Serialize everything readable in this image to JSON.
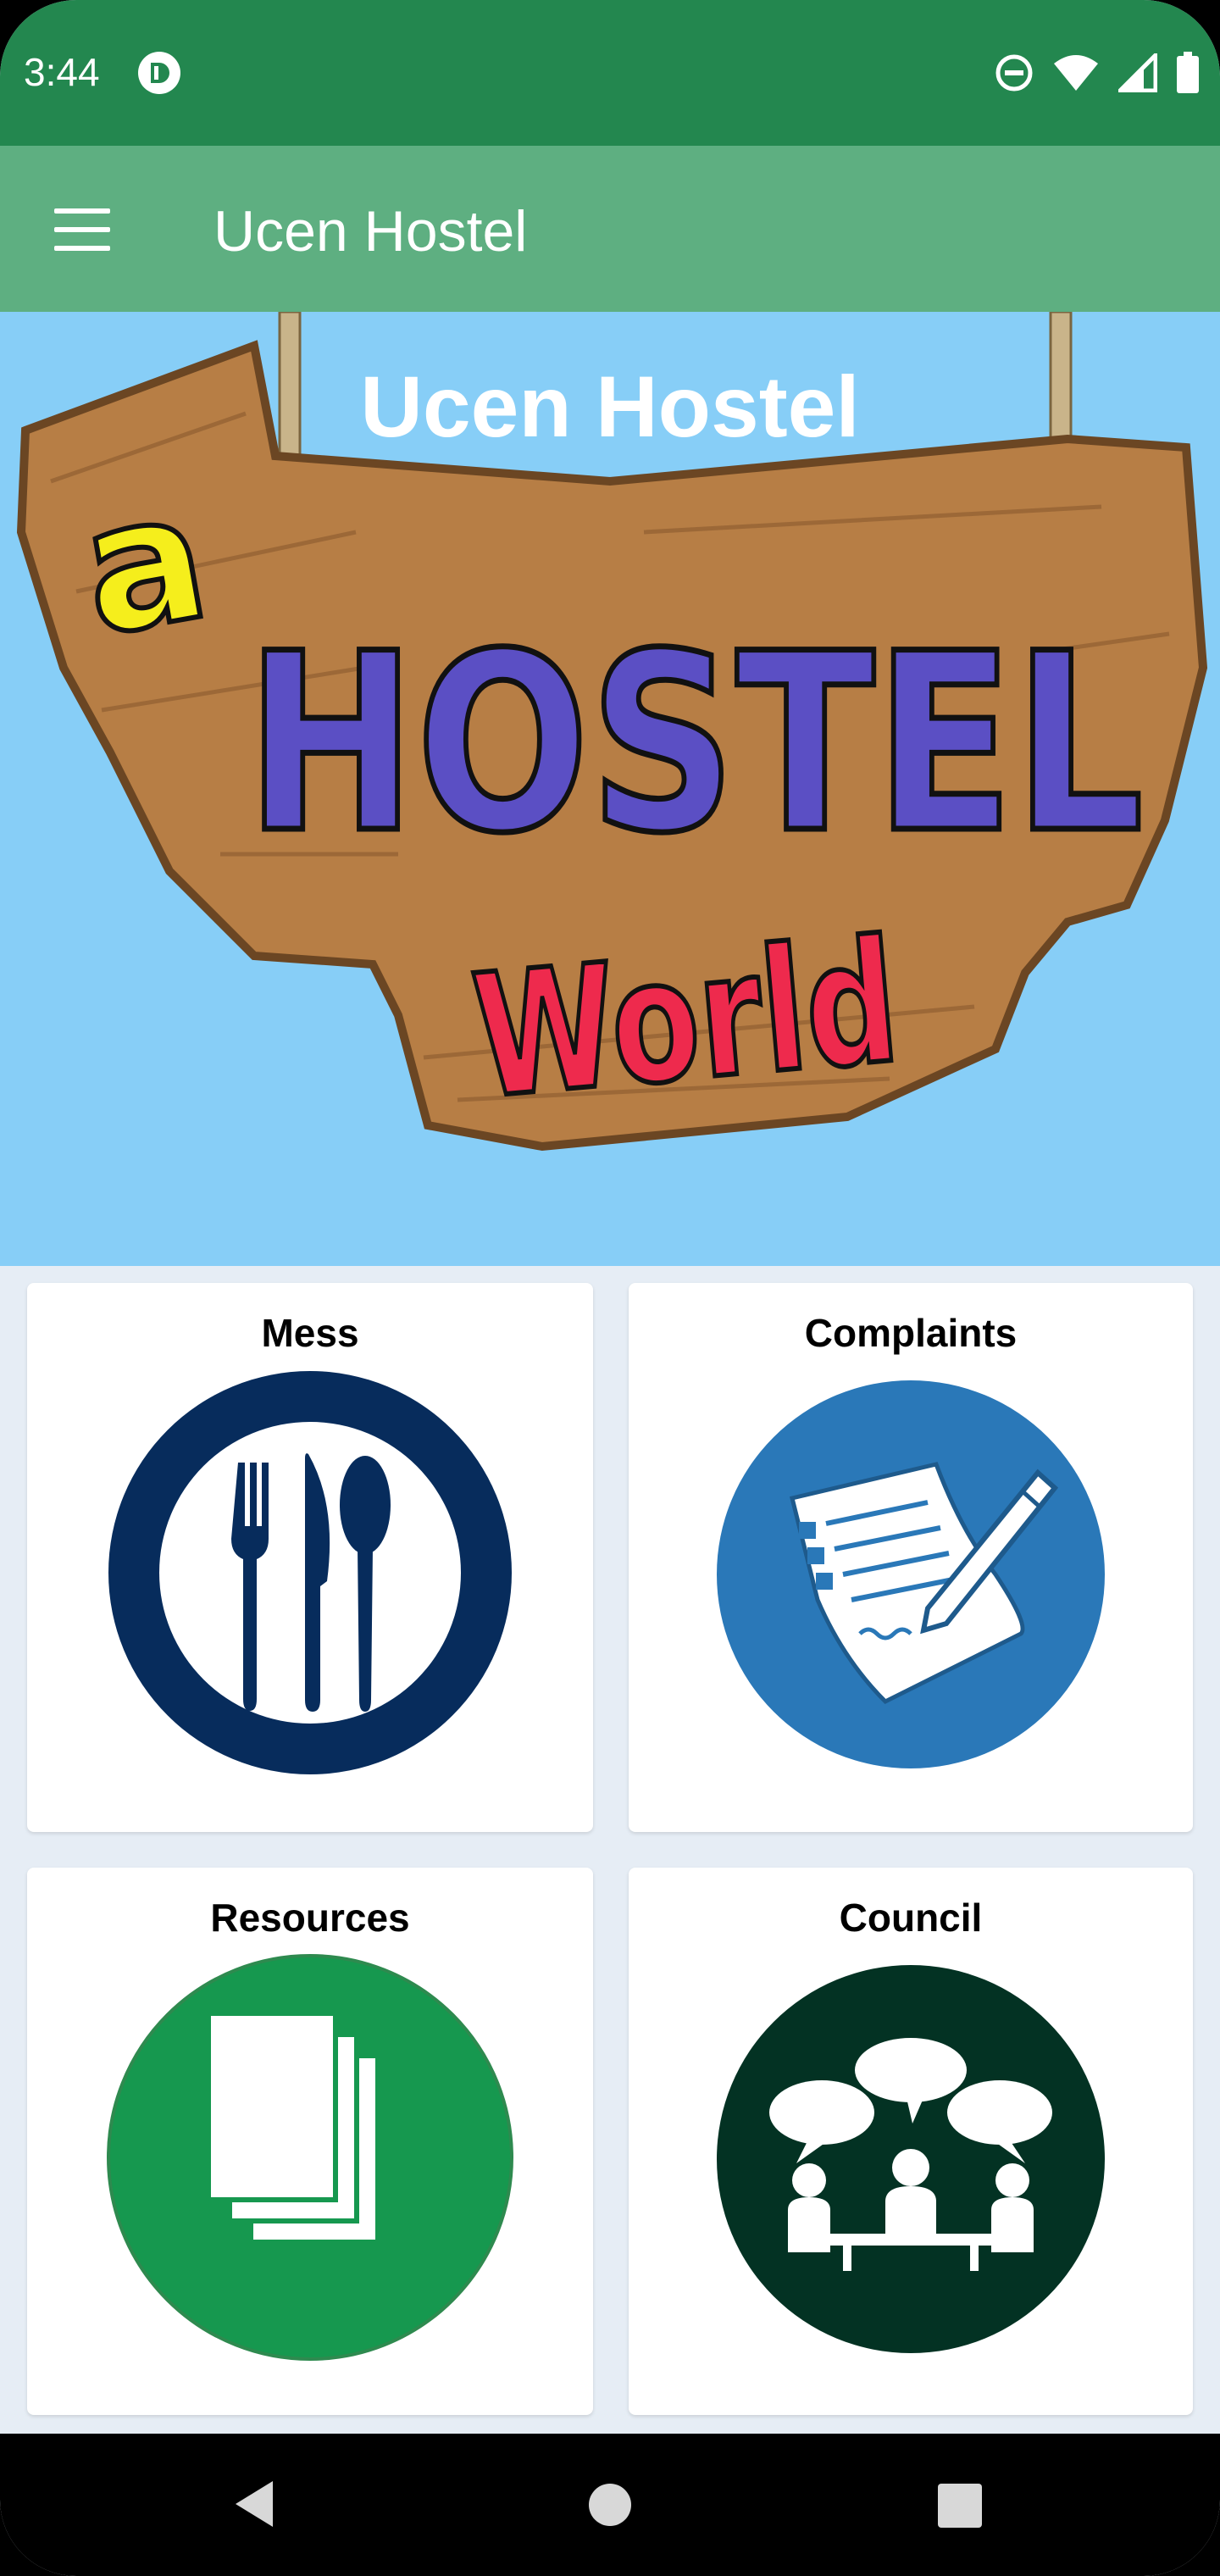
{
  "status_bar": {
    "time": "3:44",
    "icons": [
      "app-notification-icon",
      "do-not-disturb-icon",
      "wifi-icon",
      "cellular-signal-icon",
      "battery-icon"
    ]
  },
  "toolbar": {
    "menu_icon": "hamburger-menu-icon",
    "title": "Ucen Hostel"
  },
  "banner": {
    "title": "Ucen Hostel",
    "sign_words": [
      "a",
      "HOSTEL",
      "World"
    ],
    "colors": {
      "sky": "#87cef7",
      "wood": "#b77e45",
      "hostel_text": "#5b4fc4",
      "world_text": "#ee2a4d",
      "a_text": "#f5ee1c"
    }
  },
  "cards": [
    {
      "label": "Mess",
      "icon": "cutlery-plate-icon",
      "color": "#072c5c"
    },
    {
      "label": "Complaints",
      "icon": "complaint-document-pen-icon",
      "color": "#2a78b8"
    },
    {
      "label": "Resources",
      "icon": "stacked-documents-icon",
      "color": "#16984f"
    },
    {
      "label": "Council",
      "icon": "meeting-discussion-icon",
      "color": "#033223"
    }
  ],
  "nav_bar": {
    "buttons": [
      "back-icon",
      "home-icon",
      "recents-icon"
    ]
  },
  "colors": {
    "status_bar": "#23874f",
    "toolbar": "#5eaf81",
    "background": "#e6edf5"
  }
}
